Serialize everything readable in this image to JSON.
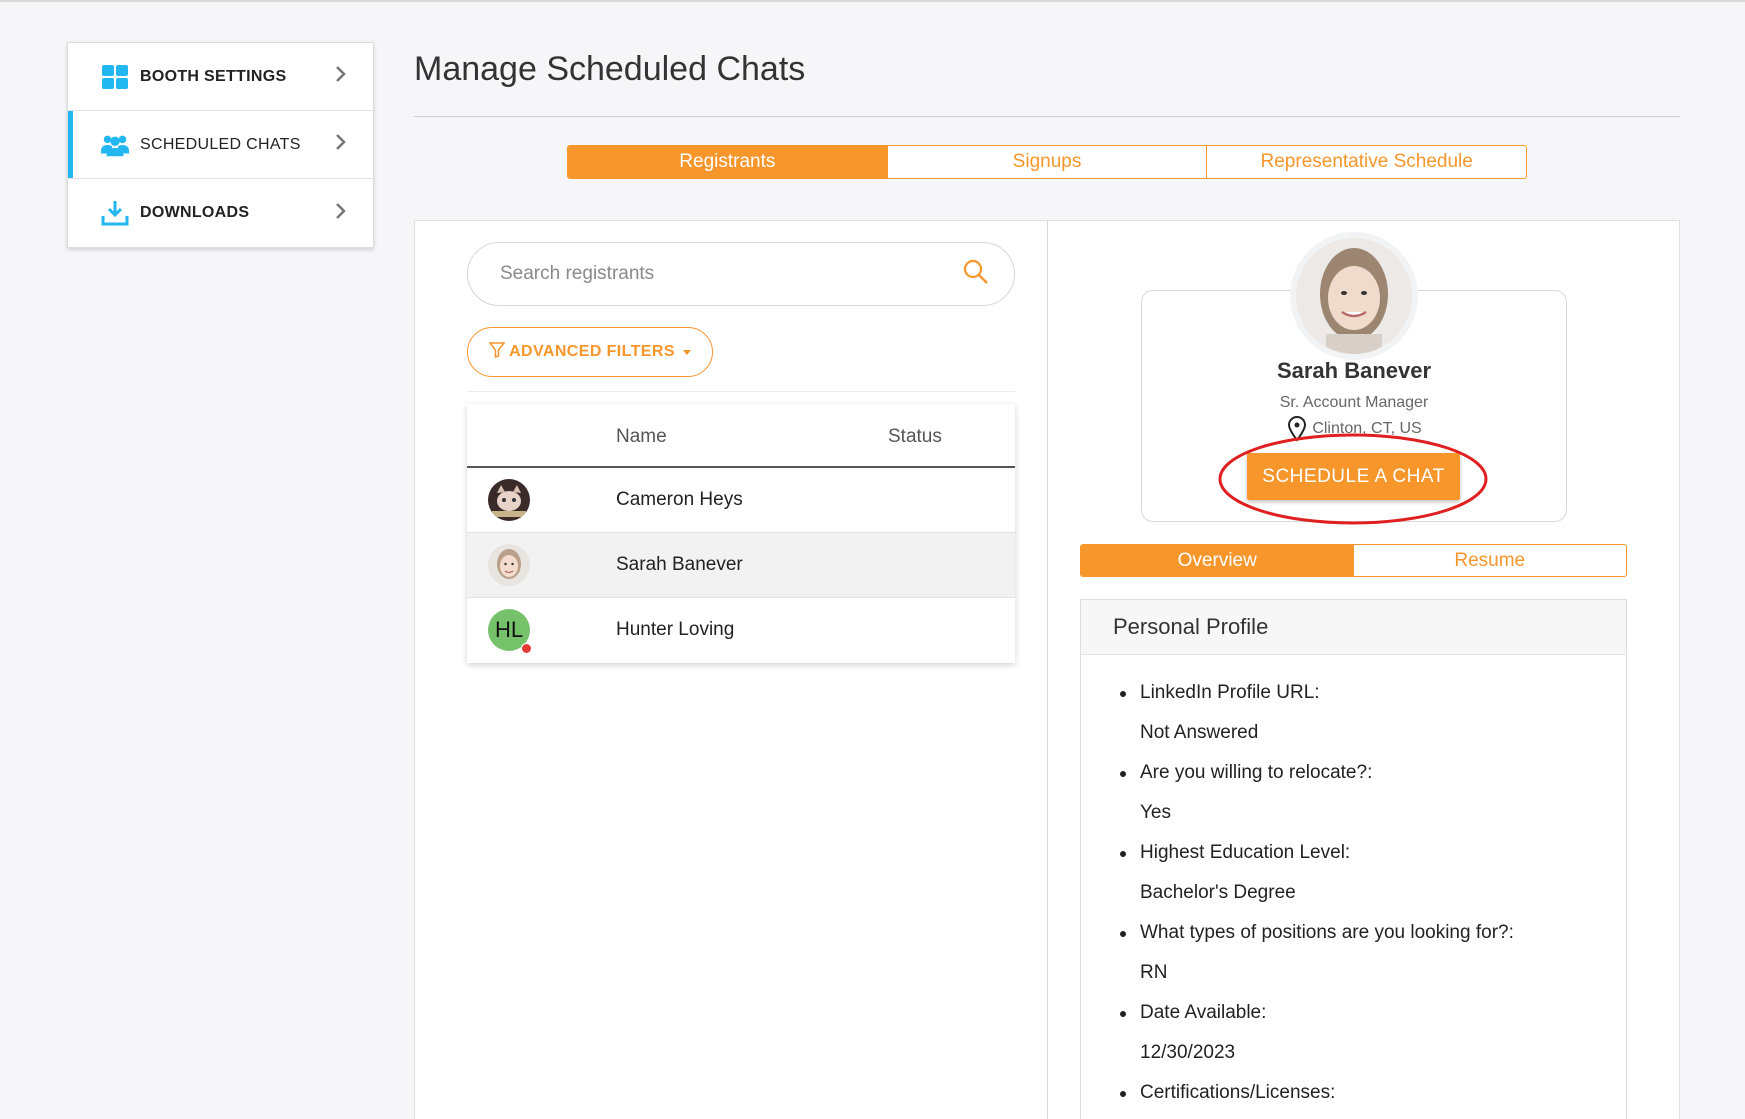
{
  "sidebar": {
    "items": [
      {
        "label": "BOOTH SETTINGS",
        "icon": "grid-icon"
      },
      {
        "label": "SCHEDULED CHATS",
        "icon": "users-icon"
      },
      {
        "label": "DOWNLOADS",
        "icon": "download-icon"
      }
    ]
  },
  "header": {
    "title": "Manage Scheduled Chats"
  },
  "tabs": [
    {
      "label": "Registrants"
    },
    {
      "label": "Signups"
    },
    {
      "label": "Representative Schedule"
    }
  ],
  "search": {
    "placeholder": "Search registrants"
  },
  "filters": {
    "label": "ADVANCED FILTERS"
  },
  "table": {
    "headers": {
      "name": "Name",
      "status": "Status"
    },
    "rows": [
      {
        "name": "Cameron Heys"
      },
      {
        "name": "Sarah Banever"
      },
      {
        "name": "Hunter Loving",
        "initials": "HL"
      }
    ]
  },
  "profile": {
    "name": "Sarah Banever",
    "role": "Sr. Account Manager",
    "location": "Clinton, CT, US",
    "schedule_label": "SCHEDULE A CHAT"
  },
  "subtabs": [
    {
      "label": "Overview"
    },
    {
      "label": "Resume"
    }
  ],
  "personal_profile": {
    "title": "Personal Profile",
    "items": [
      {
        "q": "LinkedIn Profile URL:",
        "a": "Not Answered"
      },
      {
        "q": "Are you willing to relocate?:",
        "a": "Yes"
      },
      {
        "q": "Highest Education Level:",
        "a": "Bachelor's Degree"
      },
      {
        "q": "What types of positions are you looking for?:",
        "a": "RN"
      },
      {
        "q": "Date Available:",
        "a": "12/30/2023"
      },
      {
        "q": "Certifications/Licenses:",
        "a": ""
      }
    ]
  },
  "colors": {
    "accent": "#f7962b",
    "sidebar_active": "#23b7f2",
    "icon_blue": "#23b7f2",
    "highlight": "#e02020"
  }
}
